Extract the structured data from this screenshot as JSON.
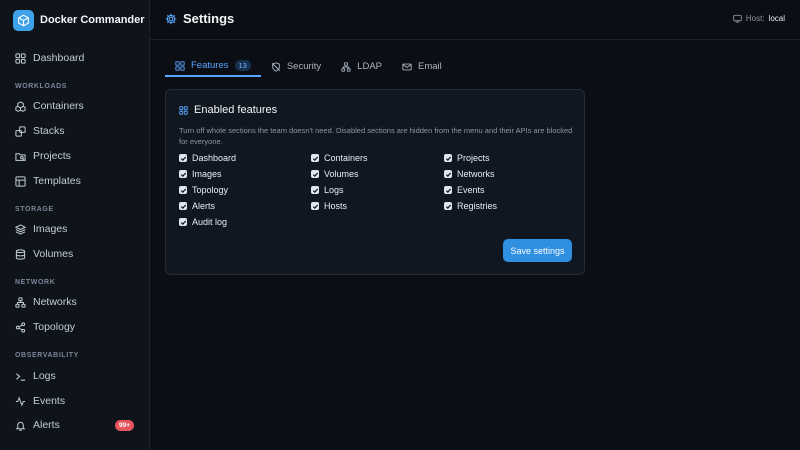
{
  "brand": {
    "name": "Docker Commander"
  },
  "sidebar": {
    "dashboard": "Dashboard",
    "sections": {
      "workloads": "WORKLOADS",
      "storage": "STORAGE",
      "network": "NETWORK",
      "observability": "OBSERVABILITY"
    },
    "items": {
      "containers": "Containers",
      "stacks": "Stacks",
      "projects": "Projects",
      "templates": "Templates",
      "images": "Images",
      "volumes": "Volumes",
      "networks": "Networks",
      "topology": "Topology",
      "logs": "Logs",
      "events": "Events",
      "alerts": "Alerts"
    },
    "alerts_badge": "99+"
  },
  "header": {
    "title": "Settings",
    "host_label": "Host:",
    "host_value": "local"
  },
  "tabs": {
    "features": {
      "label": "Features",
      "count": "13"
    },
    "security": {
      "label": "Security"
    },
    "ldap": {
      "label": "LDAP"
    },
    "email": {
      "label": "Email"
    }
  },
  "card": {
    "title": "Enabled features",
    "description": "Turn off whole sections the team doesn't need. Disabled sections are hidden from the menu and their APIs are blocked for everyone.",
    "features": [
      {
        "label": "Dashboard",
        "checked": true
      },
      {
        "label": "Containers",
        "checked": true
      },
      {
        "label": "Projects",
        "checked": true
      },
      {
        "label": "Images",
        "checked": true
      },
      {
        "label": "Volumes",
        "checked": true
      },
      {
        "label": "Networks",
        "checked": true
      },
      {
        "label": "Topology",
        "checked": true
      },
      {
        "label": "Logs",
        "checked": true
      },
      {
        "label": "Events",
        "checked": true
      },
      {
        "label": "Alerts",
        "checked": true
      },
      {
        "label": "Hosts",
        "checked": true
      },
      {
        "label": "Registries",
        "checked": true
      },
      {
        "label": "Audit log",
        "checked": true
      }
    ],
    "save_label": "Save settings"
  },
  "colors": {
    "accent": "#58a6ff",
    "button": "#2f8fe0",
    "badge": "#e5555e",
    "background": "#0b0e14"
  }
}
